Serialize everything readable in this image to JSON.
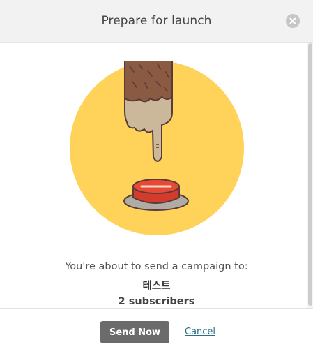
{
  "header": {
    "title": "Prepare for launch",
    "close_icon": "close-icon"
  },
  "content": {
    "illustration": "finger-pressing-red-button-illustration",
    "message": "You're about to send a campaign to:",
    "list_name": "테스트",
    "subscriber_count": "2 subscribers"
  },
  "footer": {
    "send_label": "Send Now",
    "cancel_label": "Cancel"
  },
  "colors": {
    "circle": "#ffd25a",
    "button_red": "#d33b2c",
    "send_button": "#6b6b6b",
    "link": "#2b6f85"
  }
}
